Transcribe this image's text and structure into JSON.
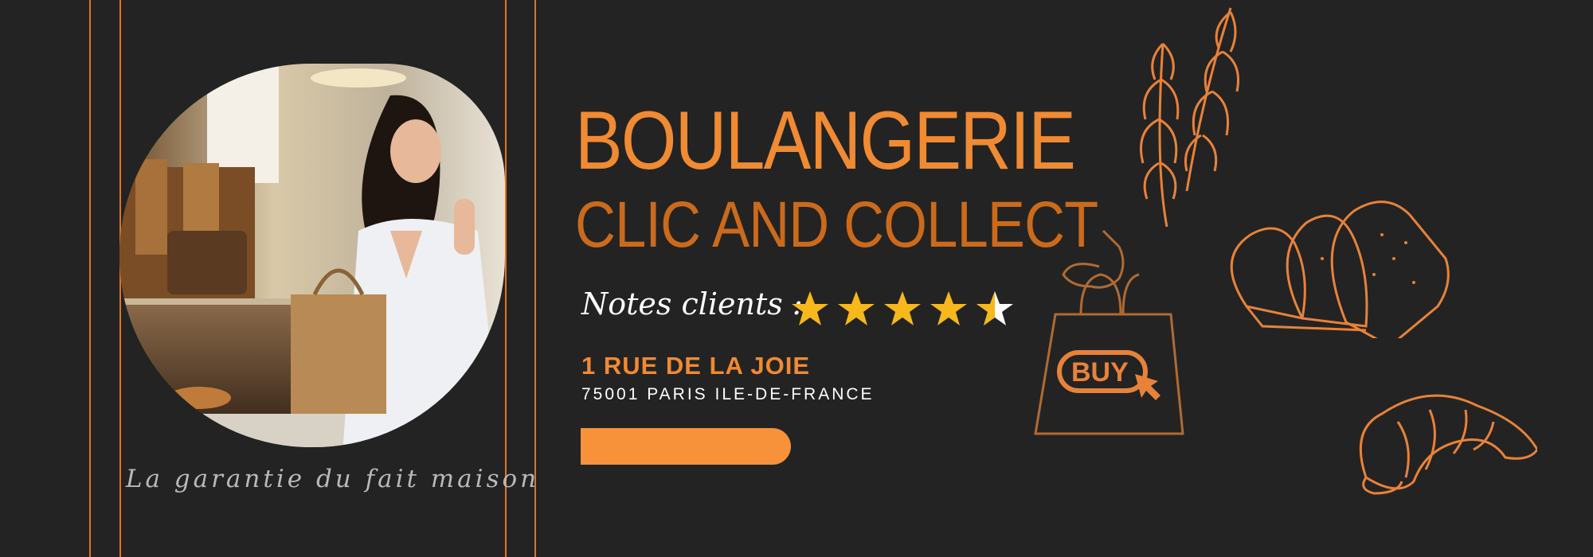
{
  "title_line1": "BOULANGERIE",
  "title_line2": "CLIC AND COLLECT",
  "rating": {
    "label": "Notes clients :",
    "value": 4.5,
    "max": 5
  },
  "address": {
    "street": "1 RUE DE LA JOIE",
    "city": "75001 PARIS ILE-DE-FRANCE"
  },
  "cta_button": {
    "label": ""
  },
  "tagline": "La garantie du fait maison",
  "buy_bag_text": "BUY",
  "icons": [
    "wheat-icon",
    "shopping-bag-icon",
    "bread-loaf-icon",
    "croissant-icon",
    "star-icon"
  ],
  "colors": {
    "background": "#232323",
    "orange_primary": "#f08a33",
    "orange_dark": "#cc6a1b",
    "star": "#f6b81a",
    "button": "#f7913a"
  }
}
